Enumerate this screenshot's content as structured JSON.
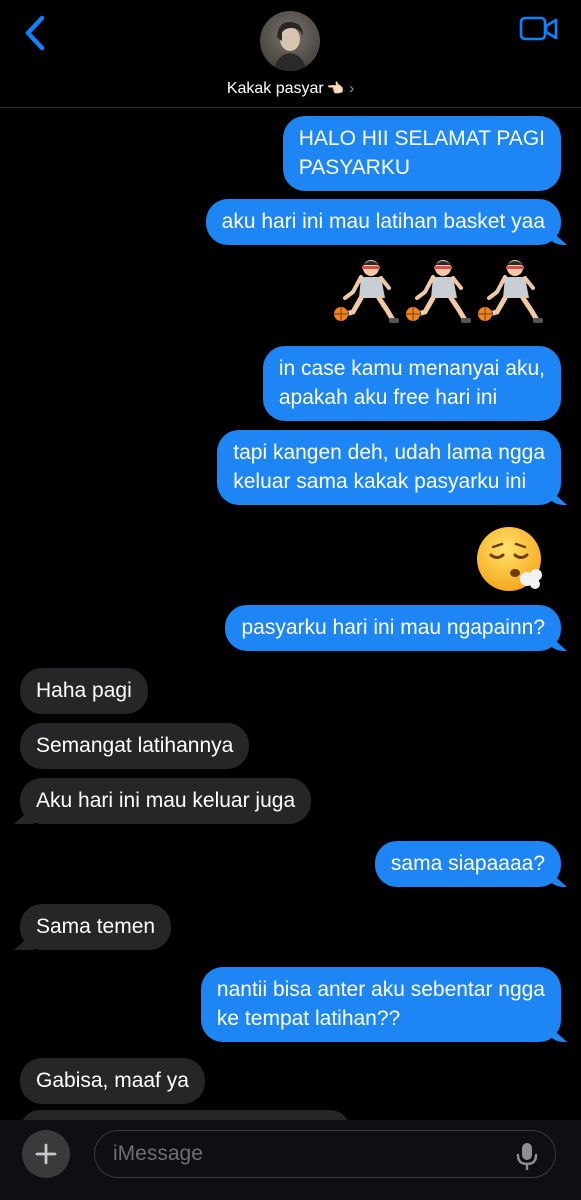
{
  "header": {
    "contact_name": "Kakak pasyar",
    "contact_emoji": "👈🏻",
    "chevron": "›",
    "back_icon": "chevron-left-icon",
    "video_icon": "video-camera-icon"
  },
  "colors": {
    "sent_bubble": "#1d86f4",
    "received_bubble": "#262628",
    "accent": "#0a84ff",
    "background": "#000000"
  },
  "messages": [
    {
      "side": "sent",
      "lines": [
        "HALO HII SELAMAT PAGI",
        "PASYARKU"
      ]
    },
    {
      "side": "sent",
      "lines": [
        "aku hari ini mau latihan basket yaa"
      ]
    },
    {
      "side": "sent",
      "type": "emoji",
      "text": "⛹🏻‍♂️⛹🏻‍♂️⛹🏻‍♂️"
    },
    {
      "side": "sent",
      "lines": [
        "in case kamu menanyai aku,",
        "apakah aku free hari ini"
      ]
    },
    {
      "side": "sent",
      "lines": [
        "tapi kangen deh, udah lama ngga",
        "keluar sama kakak pasyarku ini"
      ]
    },
    {
      "side": "sent",
      "type": "emoji",
      "text": "😮‍💨"
    },
    {
      "side": "sent",
      "lines": [
        "pasyarku hari ini mau ngapainn?"
      ]
    },
    {
      "side": "received",
      "lines": [
        "Haha pagi"
      ]
    },
    {
      "side": "received",
      "lines": [
        "Semangat latihannya"
      ]
    },
    {
      "side": "received",
      "lines": [
        "Aku hari ini mau keluar juga"
      ]
    },
    {
      "side": "sent",
      "lines": [
        "sama siapaaaa?"
      ]
    },
    {
      "side": "received",
      "lines": [
        "Sama temen"
      ]
    },
    {
      "side": "sent",
      "lines": [
        "nantii bisa anter aku sebentar ngga",
        "ke tempat latihan??"
      ]
    },
    {
      "side": "received",
      "lines": [
        "Gabisa, maaf ya"
      ]
    }
  ],
  "input": {
    "placeholder": "iMessage",
    "value": "",
    "plus_icon": "plus-icon",
    "mic_icon": "microphone-icon"
  }
}
